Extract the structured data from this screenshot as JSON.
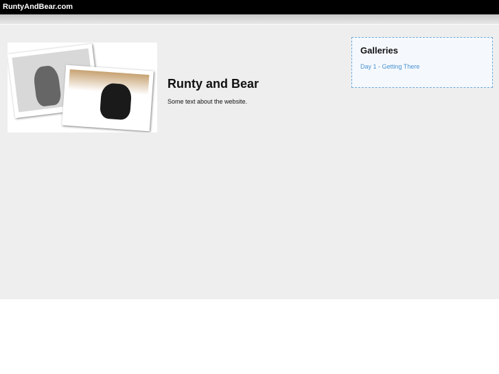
{
  "header": {
    "site_name": "RuntyAndBear.com"
  },
  "main": {
    "title": "Runty and Bear",
    "description": "Some text about the website."
  },
  "sidebar": {
    "heading": "Galleries",
    "links": [
      {
        "label": "Day 1 - Getting There"
      }
    ]
  }
}
